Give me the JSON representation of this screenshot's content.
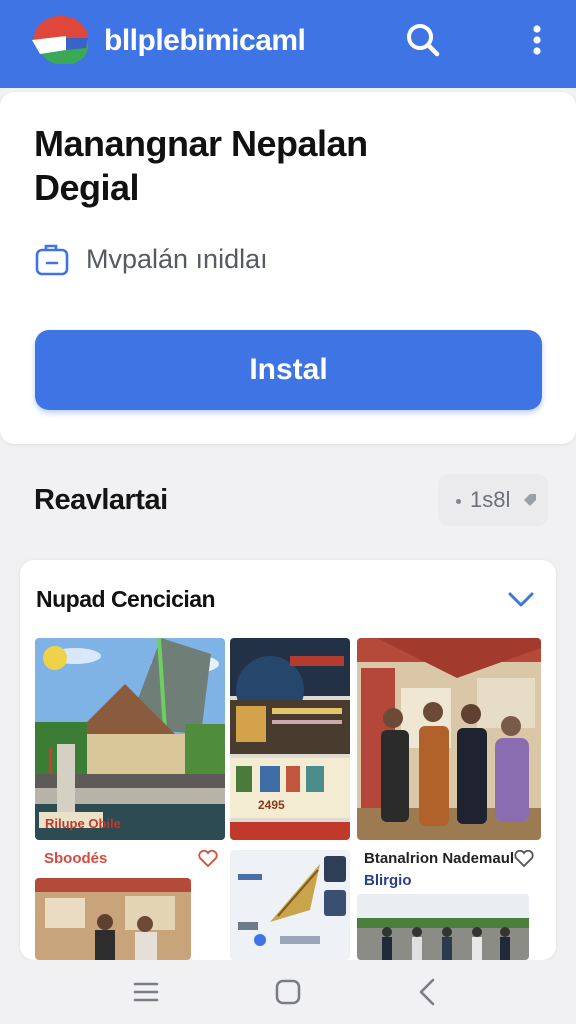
{
  "appbar": {
    "title": "bllplebimicaml",
    "logo_icon": "app-logo-icon",
    "search_icon": "search-icon",
    "more_icon": "more-vert-icon",
    "color": "#3e74e4"
  },
  "app": {
    "name": "Manangnar Nepalan Degial",
    "meta_icon": "briefcase-icon",
    "meta_text": "Mvpalán ınidlaı",
    "install_label": "Instal"
  },
  "section": {
    "title": "Reavlartai",
    "chip_label": "1s8l",
    "chip_icon": "tag-icon"
  },
  "gallery": {
    "title": "Nupad Cencician",
    "chevron_icon": "chevron-down-icon",
    "items": [
      {
        "label": "Sboodés",
        "image_text": "Rilupe Obile",
        "caption_color": "#d94b3f"
      },
      {
        "label": "",
        "image_text": "2495"
      },
      {
        "label": "Btanalrion Nademaul",
        "caption_color": "#222222"
      },
      {
        "label": ""
      },
      {
        "label": "Blirgio"
      },
      {
        "label": ""
      }
    ],
    "heart_icon": "heart-outline-icon"
  },
  "navbar": {
    "recents_icon": "recents-icon",
    "home_icon": "home-icon",
    "back_icon": "back-icon"
  }
}
